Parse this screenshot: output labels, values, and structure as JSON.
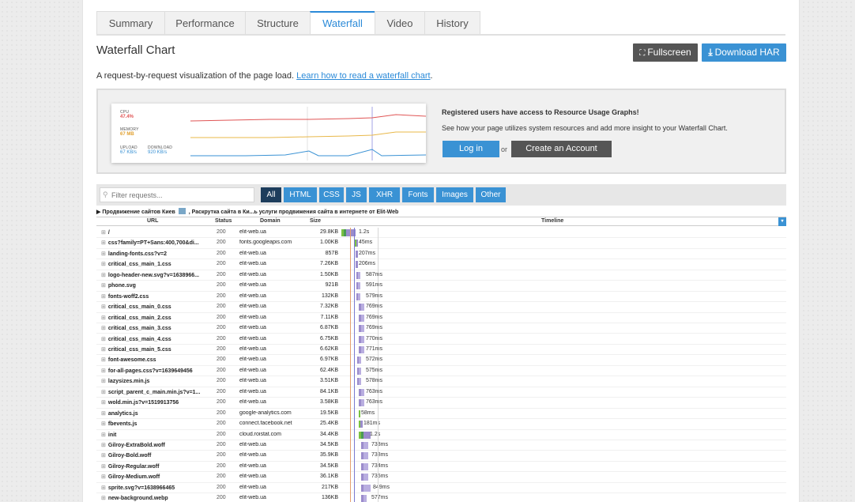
{
  "tabs": [
    {
      "label": "Summary",
      "active": false
    },
    {
      "label": "Performance",
      "active": false
    },
    {
      "label": "Structure",
      "active": false
    },
    {
      "label": "Waterfall",
      "active": true
    },
    {
      "label": "Video",
      "active": false
    },
    {
      "label": "History",
      "active": false
    }
  ],
  "header": {
    "title": "Waterfall Chart",
    "fullscreen_label": "Fullscreen",
    "download_label": "Download HAR"
  },
  "lede": {
    "text": "A request-by-request visualization of the page load.",
    "link": "Learn how to read a waterfall chart",
    "suffix": "."
  },
  "promo": {
    "graph": {
      "cpu_label": "CPU",
      "cpu_value": "47.4%",
      "memory_label": "MEMORY",
      "memory_value": "67 MB",
      "upload_label": "UPLOAD",
      "upload_value": "67 KB/s",
      "download_label": "DOWNLOAD",
      "download_value": "920 KB/s"
    },
    "title": "Registered users have access to Resource Usage Graphs!",
    "text": "See how your page utilizes system resources and add more insight to your Waterfall Chart.",
    "login_label": "Log in",
    "or_label": "or",
    "create_label": "Create an Account"
  },
  "filter": {
    "placeholder": "Filter requests...",
    "buttons": [
      {
        "label": "All",
        "active": true
      },
      {
        "label": "HTML",
        "active": false
      },
      {
        "label": "CSS",
        "active": false
      },
      {
        "label": "JS",
        "active": false
      },
      {
        "label": "XHR",
        "active": false
      },
      {
        "label": "Fonts",
        "active": false
      },
      {
        "label": "Images",
        "active": false
      },
      {
        "label": "Other",
        "active": false
      }
    ]
  },
  "page_row": {
    "before": "Продвижение сайтов Киев",
    "after": ", Раскрутка сайта в Ки...ь услуги продвижения сайта в интернете от Elit-Web"
  },
  "columns": {
    "url": "URL",
    "status": "Status",
    "domain": "Domain",
    "size": "Size",
    "timeline": "Timeline"
  },
  "colors": {
    "accent": "#3a92d4",
    "dark_button": "#555555",
    "cpu": "#e05555",
    "memory": "#e8b84a",
    "network": "#3a92d4",
    "bar_purple": "#9b8ccc",
    "bar_green": "#7ac142"
  },
  "requests": [
    {
      "url": "/",
      "status": "200",
      "domain": "elit-web.ua",
      "size": "29.8KB",
      "time": "1.2s"
    },
    {
      "url": "css?family=PT+Sans:400,700&di...",
      "status": "200",
      "domain": "fonts.googleapis.com",
      "size": "1.00KB",
      "time": "45ms"
    },
    {
      "url": "landing-fonts.css?v=2",
      "status": "200",
      "domain": "elit-web.ua",
      "size": "857B",
      "time": "207ms"
    },
    {
      "url": "critical_css_main_1.css",
      "status": "200",
      "domain": "elit-web.ua",
      "size": "7.26KB",
      "time": "206ms"
    },
    {
      "url": "logo-header-new.svg?v=1638966...",
      "status": "200",
      "domain": "elit-web.ua",
      "size": "1.50KB",
      "time": "587ms"
    },
    {
      "url": "phone.svg",
      "status": "200",
      "domain": "elit-web.ua",
      "size": "921B",
      "time": "591ms"
    },
    {
      "url": "fonts-woff2.css",
      "status": "200",
      "domain": "elit-web.ua",
      "size": "132KB",
      "time": "579ms"
    },
    {
      "url": "critical_css_main_0.css",
      "status": "200",
      "domain": "elit-web.ua",
      "size": "7.32KB",
      "time": "769ms"
    },
    {
      "url": "critical_css_main_2.css",
      "status": "200",
      "domain": "elit-web.ua",
      "size": "7.11KB",
      "time": "769ms"
    },
    {
      "url": "critical_css_main_3.css",
      "status": "200",
      "domain": "elit-web.ua",
      "size": "6.87KB",
      "time": "769ms"
    },
    {
      "url": "critical_css_main_4.css",
      "status": "200",
      "domain": "elit-web.ua",
      "size": "6.75KB",
      "time": "770ms"
    },
    {
      "url": "critical_css_main_5.css",
      "status": "200",
      "domain": "elit-web.ua",
      "size": "6.62KB",
      "time": "771ms"
    },
    {
      "url": "font-awesome.css",
      "status": "200",
      "domain": "elit-web.ua",
      "size": "6.97KB",
      "time": "572ms"
    },
    {
      "url": "for-all-pages.css?v=1639649456",
      "status": "200",
      "domain": "elit-web.ua",
      "size": "62.4KB",
      "time": "575ms"
    },
    {
      "url": "lazysizes.min.js",
      "status": "200",
      "domain": "elit-web.ua",
      "size": "3.51KB",
      "time": "578ms"
    },
    {
      "url": "script_parent_c_main.min.js?v=1...",
      "status": "200",
      "domain": "elit-web.ua",
      "size": "84.1KB",
      "time": "763ms"
    },
    {
      "url": "wold.min.js?v=1519913756",
      "status": "200",
      "domain": "elit-web.ua",
      "size": "3.58KB",
      "time": "763ms"
    },
    {
      "url": "analytics.js",
      "status": "200",
      "domain": "google-analytics.com",
      "size": "19.5KB",
      "time": "58ms"
    },
    {
      "url": "fbevents.js",
      "status": "200",
      "domain": "connect.facebook.net",
      "size": "25.4KB",
      "time": "181ms"
    },
    {
      "url": "init",
      "status": "200",
      "domain": "cloud.roistat.com",
      "size": "34.4KB",
      "time": "1.2s"
    },
    {
      "url": "Gilroy-ExtraBold.woff",
      "status": "200",
      "domain": "elit-web.ua",
      "size": "34.5KB",
      "time": "738ms"
    },
    {
      "url": "Gilroy-Bold.woff",
      "status": "200",
      "domain": "elit-web.ua",
      "size": "35.9KB",
      "time": "738ms"
    },
    {
      "url": "Gilroy-Regular.woff",
      "status": "200",
      "domain": "elit-web.ua",
      "size": "34.5KB",
      "time": "734ms"
    },
    {
      "url": "Gilroy-Medium.woff",
      "status": "200",
      "domain": "elit-web.ua",
      "size": "36.1KB",
      "time": "735ms"
    },
    {
      "url": "sprite.svg?v=1638966465",
      "status": "200",
      "domain": "elit-web.ua",
      "size": "217KB",
      "time": "849ms"
    },
    {
      "url": "new-background.webp",
      "status": "200",
      "domain": "elit-web.ua",
      "size": "136KB",
      "time": "577ms"
    }
  ]
}
